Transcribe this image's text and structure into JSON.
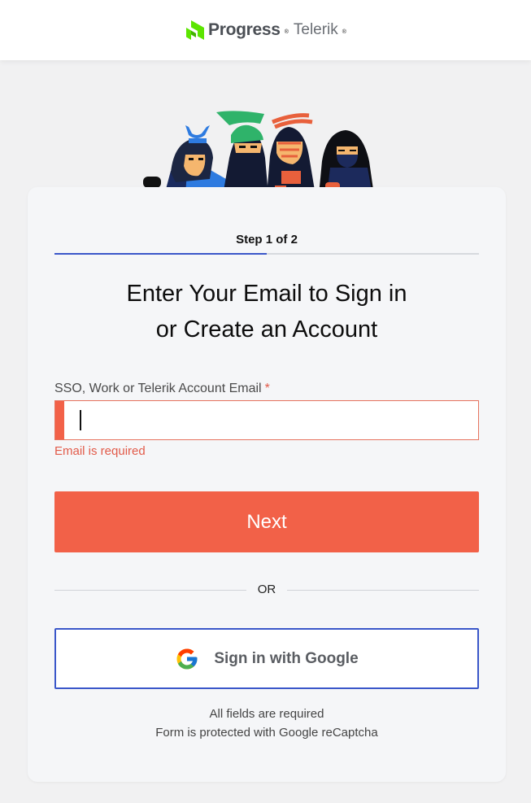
{
  "header": {
    "logo_brand": "Progress",
    "logo_product": "Telerik",
    "logo_mark_color": "#5ce500"
  },
  "form": {
    "step_label": "Step 1 of 2",
    "step_progress": 0.5,
    "heading_line1": "Enter Your Email to Sign in",
    "heading_line2": "or Create an Account",
    "email_label": "SSO, Work or Telerik Account Email",
    "required_marker": "*",
    "email_value": "",
    "email_placeholder": "",
    "email_error": "Email is required",
    "next_label": "Next",
    "or_label": "OR",
    "google_label": "Sign in with Google",
    "note_required": "All fields are required",
    "note_recaptcha": "Form is protected with Google reCaptcha"
  },
  "colors": {
    "accent_red": "#f26148",
    "accent_blue": "#3a57c9",
    "error_text": "#e25b4a",
    "card_bg": "#f5f6f8",
    "page_bg": "#f1f1f2"
  },
  "icons": {
    "logo": "progress-logo-icon",
    "illustration": "ninja-mascots",
    "google": "google-g-icon"
  }
}
